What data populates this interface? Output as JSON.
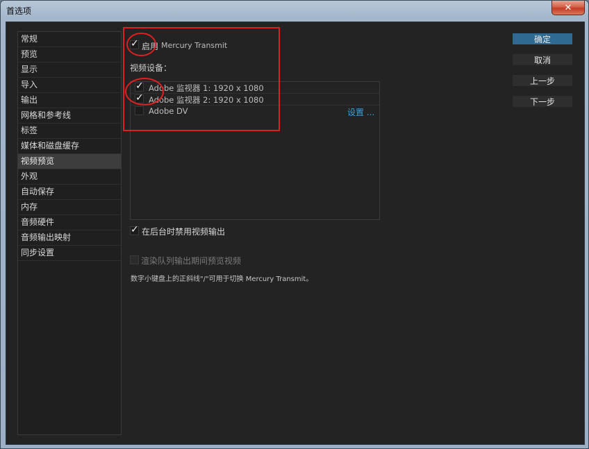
{
  "window": {
    "title": "首选项",
    "close_glyph": "✕"
  },
  "sidebar": {
    "items": [
      {
        "label": "常规"
      },
      {
        "label": "预览"
      },
      {
        "label": "显示"
      },
      {
        "label": "导入"
      },
      {
        "label": "输出"
      },
      {
        "label": "网格和参考线"
      },
      {
        "label": "标签"
      },
      {
        "label": "媒体和磁盘缓存"
      },
      {
        "label": "视频预览",
        "selected": true
      },
      {
        "label": "外观"
      },
      {
        "label": "自动保存"
      },
      {
        "label": "内存"
      },
      {
        "label": "音频硬件"
      },
      {
        "label": "音频输出映射"
      },
      {
        "label": "同步设置"
      }
    ]
  },
  "video_preview": {
    "enable_label": "启用",
    "enable_checked": true,
    "product_name": "Mercury Transmit",
    "devices_label": "视频设备：",
    "devices": [
      {
        "name": "Adobe 监视器 1: 1920 x 1080",
        "checked": true
      },
      {
        "name": "Adobe 监视器 2: 1920 x 1080",
        "checked": true
      },
      {
        "name": "Adobe DV",
        "checked": false,
        "settings_label": "设置 ..."
      }
    ],
    "disable_background_label": "在后台时禁用视频输出",
    "disable_background_checked": true,
    "render_queue_label": "渲染队列输出期间预览视频",
    "render_queue_checked": false,
    "hint": "数字小键盘上的正斜线\"/\"可用于切换 Mercury Transmit。"
  },
  "buttons": {
    "ok": "确定",
    "cancel": "取消",
    "prev": "上一步",
    "next": "下一步"
  },
  "colors": {
    "annotation": "#e01f1f",
    "link": "#3aa3dc",
    "primary_button": "#2f6a92"
  }
}
